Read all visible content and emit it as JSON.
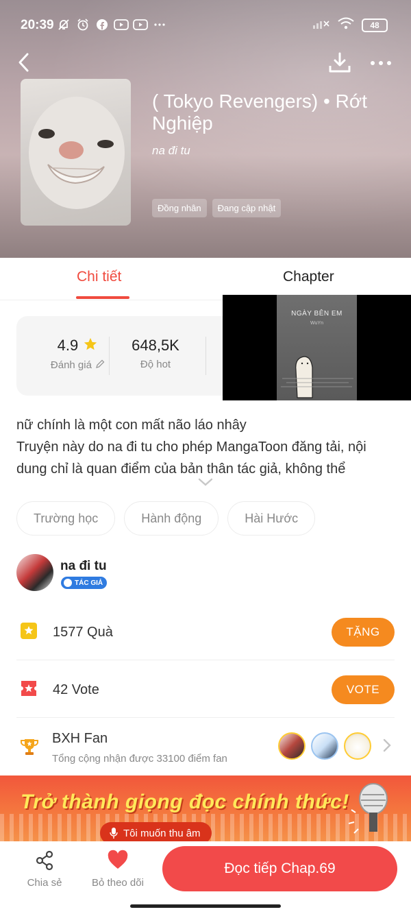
{
  "status": {
    "time": "20:39",
    "battery": "48",
    "notification_icons": [
      "bell-off-icon",
      "alarm-icon",
      "facebook-icon",
      "youtube-icon",
      "youtube-icon",
      "more-dots-icon"
    ]
  },
  "comic": {
    "title": "( Tokyo Revengers) • Rớt Nghiệp",
    "author": "na đi tu",
    "tags": [
      "Đồng nhân",
      "Đang cập nhật"
    ]
  },
  "tabs": {
    "detail": "Chi tiết",
    "chapter": "Chapter",
    "active": "detail"
  },
  "stats": {
    "rating_value": "4.9",
    "rating_label": "Đánh giá",
    "hot_value": "648,5K",
    "hot_label": "Độ hot"
  },
  "video": {
    "title": "NGÀY BÊN EM",
    "subtitle": "WuYn"
  },
  "description": [
    "nữ chính là một con mất não láo nhây",
    "Truyện này do na đi tu cho phép MangaToon đăng tải, nội",
    "dung chỉ là quan điểm của bản thân tác giả, không thể"
  ],
  "genres": [
    "Trường học",
    "Hành động",
    "Hài Hước"
  ],
  "author_card": {
    "name": "na đi tu",
    "badge": "TÁC GIẢ"
  },
  "gift": {
    "label": "1577 Quà",
    "button": "TẶNG"
  },
  "vote": {
    "label": "42 Vote",
    "button": "VOTE"
  },
  "fan_rank": {
    "title": "BXH Fan",
    "subtitle": "Tổng cộng nhận được 33100 điểm fan"
  },
  "banner": {
    "headline": "Trở thành giọng đọc chính thức!",
    "button": "Tôi muốn thu âm"
  },
  "bottom": {
    "share_label": "Chia sẻ",
    "unfollow_label": "Bỏ theo dõi",
    "read_button": "Đọc tiếp Chap.69"
  },
  "colors": {
    "accent": "#f04a3e",
    "orange": "#f58a1f",
    "star": "#f5c518",
    "read_button": "#f24a4a"
  }
}
